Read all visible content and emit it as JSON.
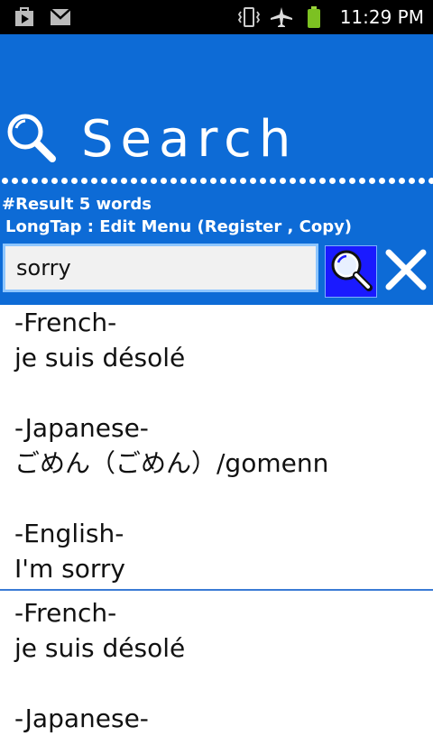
{
  "status_bar": {
    "time": "11:29 PM",
    "left_icons": [
      "play-store-icon",
      "gmail-icon"
    ],
    "right_icons": [
      "vibrate-icon",
      "airplane-icon",
      "battery-icon"
    ]
  },
  "header": {
    "title": "Search",
    "result_info": "#Result 5 words",
    "hint": "LongTap : Edit Menu (Register , Copy)",
    "bg_color": "#0d6bd6"
  },
  "search": {
    "value": "sorry",
    "button_icon": "search-icon",
    "clear_icon": "close-icon"
  },
  "results": [
    {
      "entries": [
        {
          "lang": "-French-",
          "text": "je suis désolé"
        },
        {
          "lang": "-Japanese-",
          "text": "ごめん（ごめん）/gomenn"
        },
        {
          "lang": "-English-",
          "text": "I'm sorry"
        }
      ]
    },
    {
      "entries": [
        {
          "lang": "-French-",
          "text": "je suis désolé"
        },
        {
          "lang": "-Japanese-",
          "text": ""
        }
      ]
    }
  ]
}
